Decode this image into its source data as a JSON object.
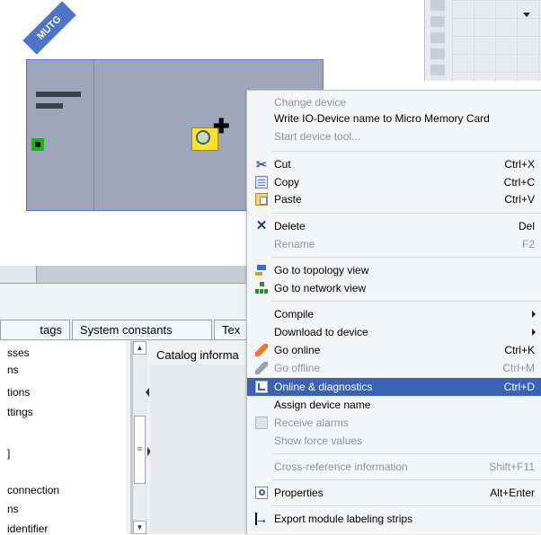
{
  "device": {
    "tag_label": "MUTG"
  },
  "tabs": {
    "items": [
      {
        "label": "tags"
      },
      {
        "label": "System constants"
      },
      {
        "label": "Tex"
      }
    ]
  },
  "left_list": {
    "items": [
      {
        "label": "sses"
      },
      {
        "label": "ns"
      },
      {
        "label": "tions"
      },
      {
        "label": "ttings"
      },
      {
        "label": "]"
      },
      {
        "label": "connection"
      },
      {
        "label": "ns"
      },
      {
        "label": "identifier"
      }
    ]
  },
  "catalog": {
    "label": "Catalog informa"
  },
  "context_menu": {
    "change_device": "Change device",
    "write_io": "Write IO-Device name to Micro Memory Card",
    "start_tool": "Start device tool...",
    "cut": {
      "label": "Cut",
      "shortcut": "Ctrl+X"
    },
    "copy": {
      "label": "Copy",
      "shortcut": "Ctrl+C"
    },
    "paste": {
      "label": "Paste",
      "shortcut": "Ctrl+V"
    },
    "delete": {
      "label": "Delete",
      "shortcut": "Del"
    },
    "rename": {
      "label": "Rename",
      "shortcut": "F2"
    },
    "topology": "Go to topology view",
    "network": "Go to network view",
    "compile": "Compile",
    "download": "Download to device",
    "go_online": {
      "label": "Go online",
      "shortcut": "Ctrl+K"
    },
    "go_offline": {
      "label": "Go offline",
      "shortcut": "Ctrl+M"
    },
    "online_diag": {
      "label": "Online & diagnostics",
      "shortcut": "Ctrl+D"
    },
    "assign_name": "Assign device name",
    "receive_alarms": "Receive alarms",
    "show_force": "Show force values",
    "cross_ref": {
      "label": "Cross-reference information",
      "shortcut": "Shift+F11"
    },
    "properties": {
      "label": "Properties",
      "shortcut": "Alt+Enter"
    },
    "export_strips": "Export module labeling strips"
  }
}
